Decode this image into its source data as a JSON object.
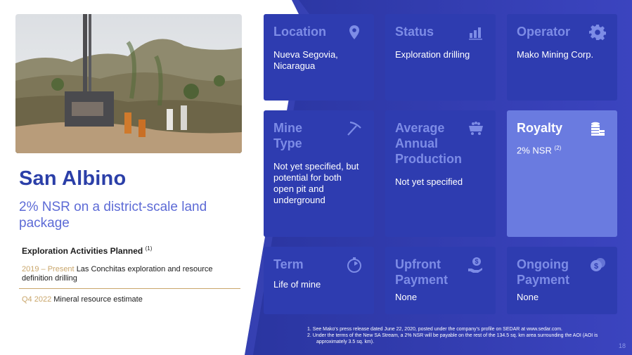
{
  "project": {
    "title": "San Albino",
    "subtitle": "2% NSR on a district-scale land package"
  },
  "plan": {
    "heading": "Exploration Activities Planned",
    "heading_note": "(1)",
    "items": [
      {
        "period": "2019 – Present",
        "text": "Las Conchitas exploration and resource definition drilling"
      },
      {
        "period": "Q4 2022",
        "text": "Mineral resource estimate"
      }
    ]
  },
  "cards": {
    "location": {
      "label": "Location",
      "value": "Nueva Segovia, Nicaragua",
      "icon": "map-pin-icon"
    },
    "status": {
      "label": "Status",
      "value": "Exploration drilling",
      "icon": "bar-chart-icon"
    },
    "operator": {
      "label": "Operator",
      "value": "Mako Mining Corp.",
      "icon": "gear-icon"
    },
    "mine_type": {
      "label": "Mine Type",
      "value": "Not yet specified, but potential for both open pit and underground",
      "icon": "pickaxe-icon"
    },
    "avg_production": {
      "label": "Average Annual Production",
      "value": "Not yet specified",
      "icon": "mine-cart-icon"
    },
    "royalty": {
      "label": "Royalty",
      "value": "2% NSR",
      "note": "(2)",
      "icon": "coin-stack-icon"
    },
    "term": {
      "label": "Term",
      "value": "Life of mine",
      "icon": "stopwatch-icon"
    },
    "upfront": {
      "label": "Upfront Payment",
      "value": "None",
      "icon": "hand-dollar-icon"
    },
    "ongoing": {
      "label": "Ongoing Payment",
      "value": "None",
      "icon": "coins-icon"
    }
  },
  "footnotes": [
    "1.   See Mako's press release dated June 22, 2020, posted under the company's profile on SEDAR at www.sedar.com.",
    "2.   Under the terms of the New SA Stream, a 2% NSR will be payable on the rest of the 134.5 sq. km area surrounding the AOI (AOI is approximately 3.5 sq. km)."
  ],
  "page_number": "18",
  "colors": {
    "navy": "#2b3fa8",
    "card": "#2e3cb0",
    "card_highlight": "#6a7be0",
    "label": "#7d8ce6",
    "gold": "#c9a66b"
  }
}
